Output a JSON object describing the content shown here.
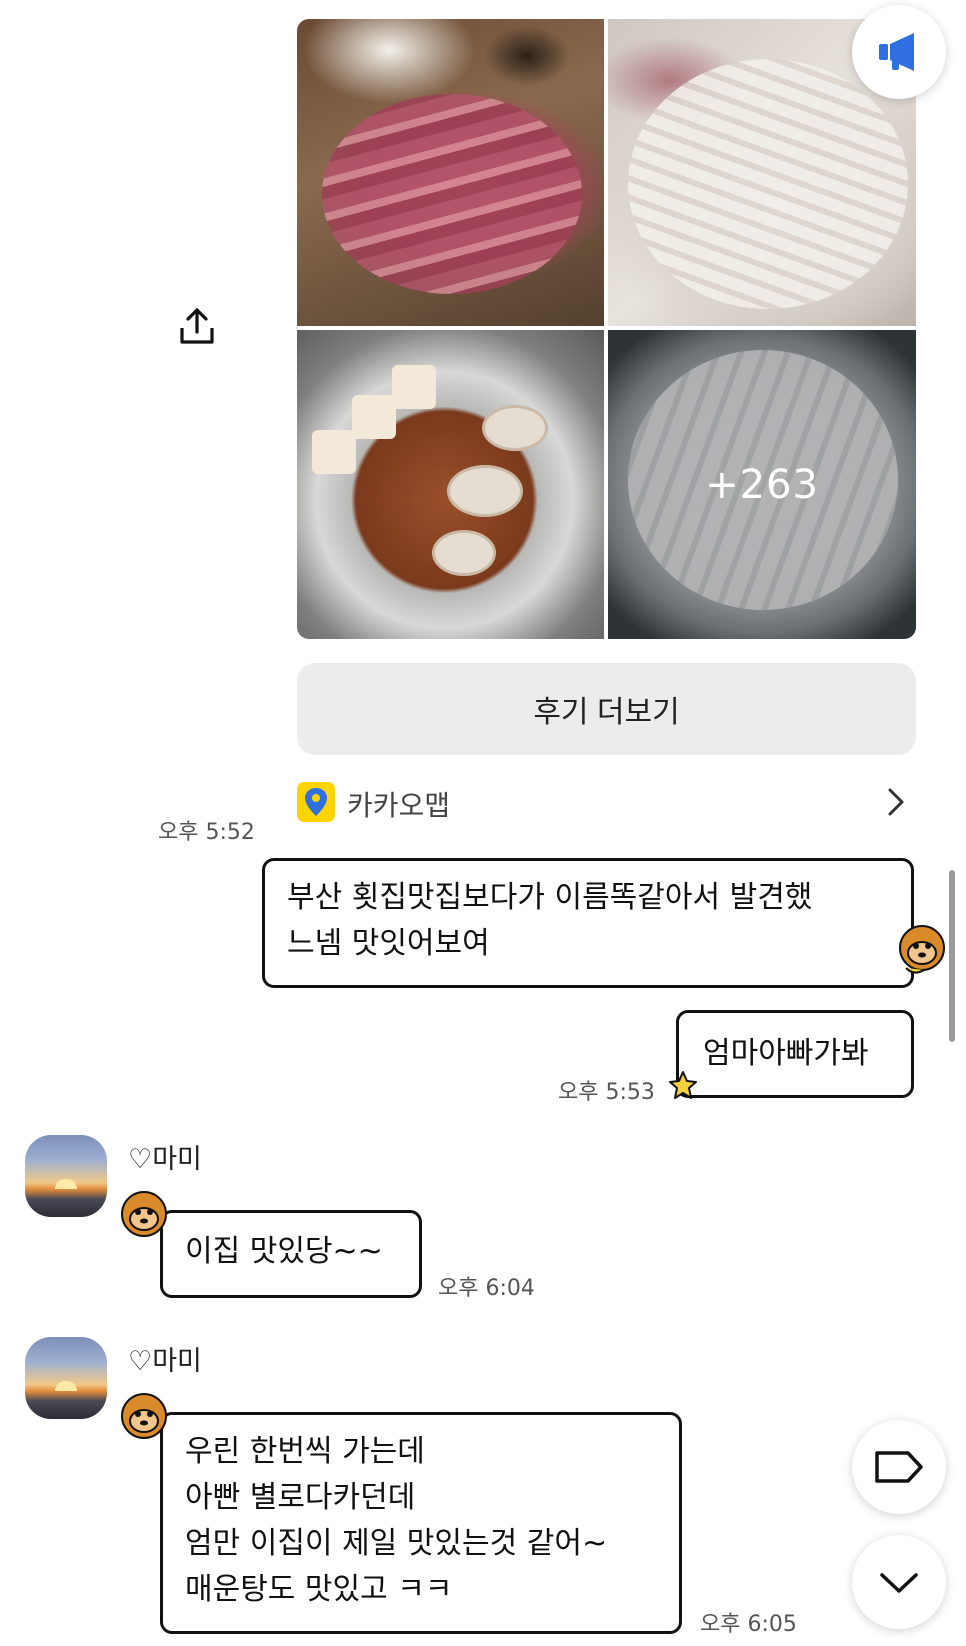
{
  "photo_grid": {
    "more_count": "+263"
  },
  "review_button": {
    "label": "후기 더보기"
  },
  "map_card": {
    "label": "카카오맵",
    "icon": "map-pin-icon"
  },
  "messages": [
    {
      "time": "오후 5:52"
    },
    {
      "text_line1": "부산 횟집맛집보다가 이름똑같아서 발견했",
      "text_line2": "느넴 맛잇어보여"
    },
    {
      "text": "엄마아빠가봐",
      "time": "오후 5:53"
    },
    {
      "sender": "♡마미",
      "text": "이집 맛있당~~",
      "time": "오후 6:04"
    },
    {
      "sender": "♡마미",
      "lines": [
        "우린 한번씩 가는데",
        "아빤 별로다카던데",
        "엄만 이집이 제일 맛있는것 같어~",
        "매운탕도 맛있고 ㅋㅋ"
      ],
      "time": "오후 6:05"
    }
  ],
  "icons": {
    "share": "share-icon",
    "notice": "megaphone-icon",
    "tag": "tag-icon",
    "scroll_down": "chevron-down-icon"
  },
  "colors": {
    "accent_blue": "#2f6fe0",
    "map_yellow": "#ffd400",
    "bubble_border": "#111111"
  }
}
